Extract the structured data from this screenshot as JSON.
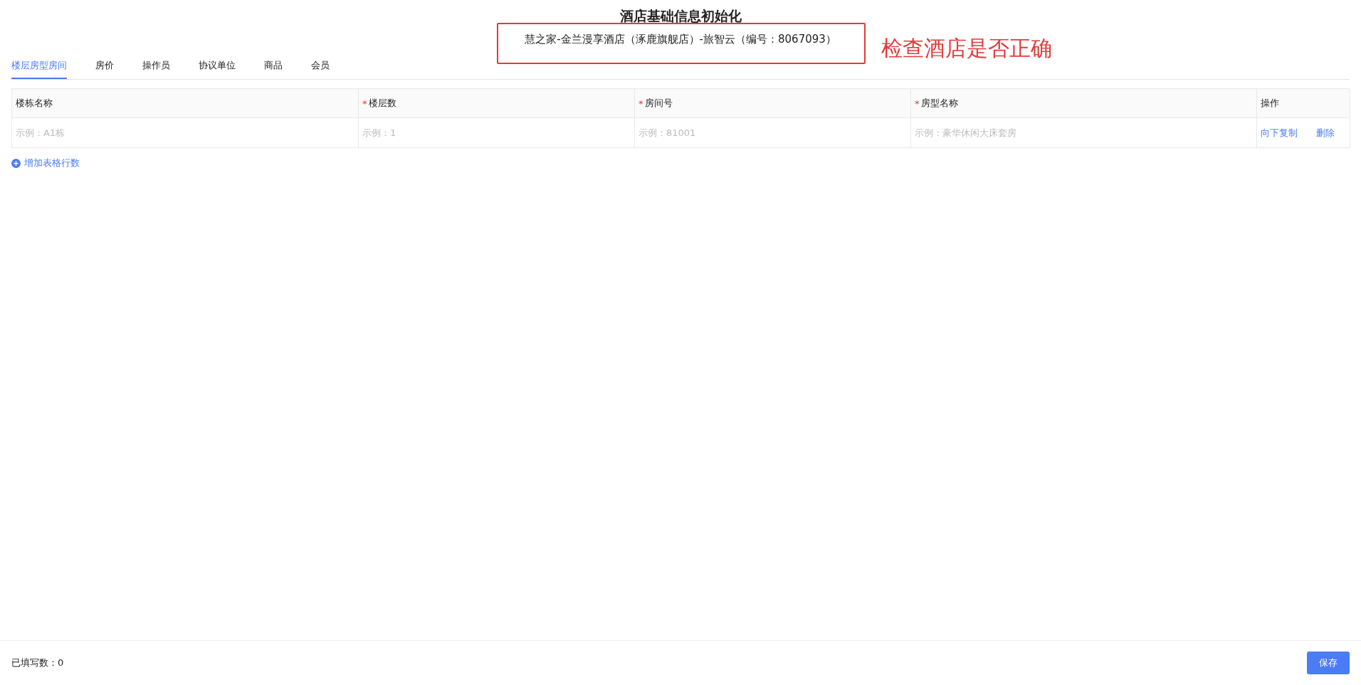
{
  "title": "酒店基础信息初始化",
  "hotel": "慧之家-金兰漫享酒店（涿鹿旗舰店）-旅智云（编号：8067093）",
  "annotation": "检查酒店是否正确",
  "tabs": [
    {
      "label": "楼层房型房间",
      "selected": true
    },
    {
      "label": "房价",
      "selected": false
    },
    {
      "label": "操作员",
      "selected": false
    },
    {
      "label": "协议单位",
      "selected": false
    },
    {
      "label": "商品",
      "selected": false
    },
    {
      "label": "会员",
      "selected": false
    }
  ],
  "table": {
    "columns": [
      {
        "label": "楼栋名称"
      },
      {
        "label": "楼层数",
        "required_mark": "*"
      },
      {
        "label": "房间号",
        "required_mark": "*"
      },
      {
        "label": "房型名称",
        "required_mark": "*"
      },
      {
        "label": "操作"
      }
    ],
    "rows": [
      {
        "cells": [
          {
            "placeholder": "示例：A1栋"
          },
          {
            "placeholder": "示例：1"
          },
          {
            "placeholder": "示例：81001"
          },
          {
            "placeholder": "示例：豪华休闲大床套房"
          }
        ],
        "actions": [
          "向下复制",
          "删除"
        ]
      }
    ]
  },
  "add_row": "增加表格行数",
  "footer": {
    "filled_label": "已填写数：0",
    "save": "保存"
  }
}
